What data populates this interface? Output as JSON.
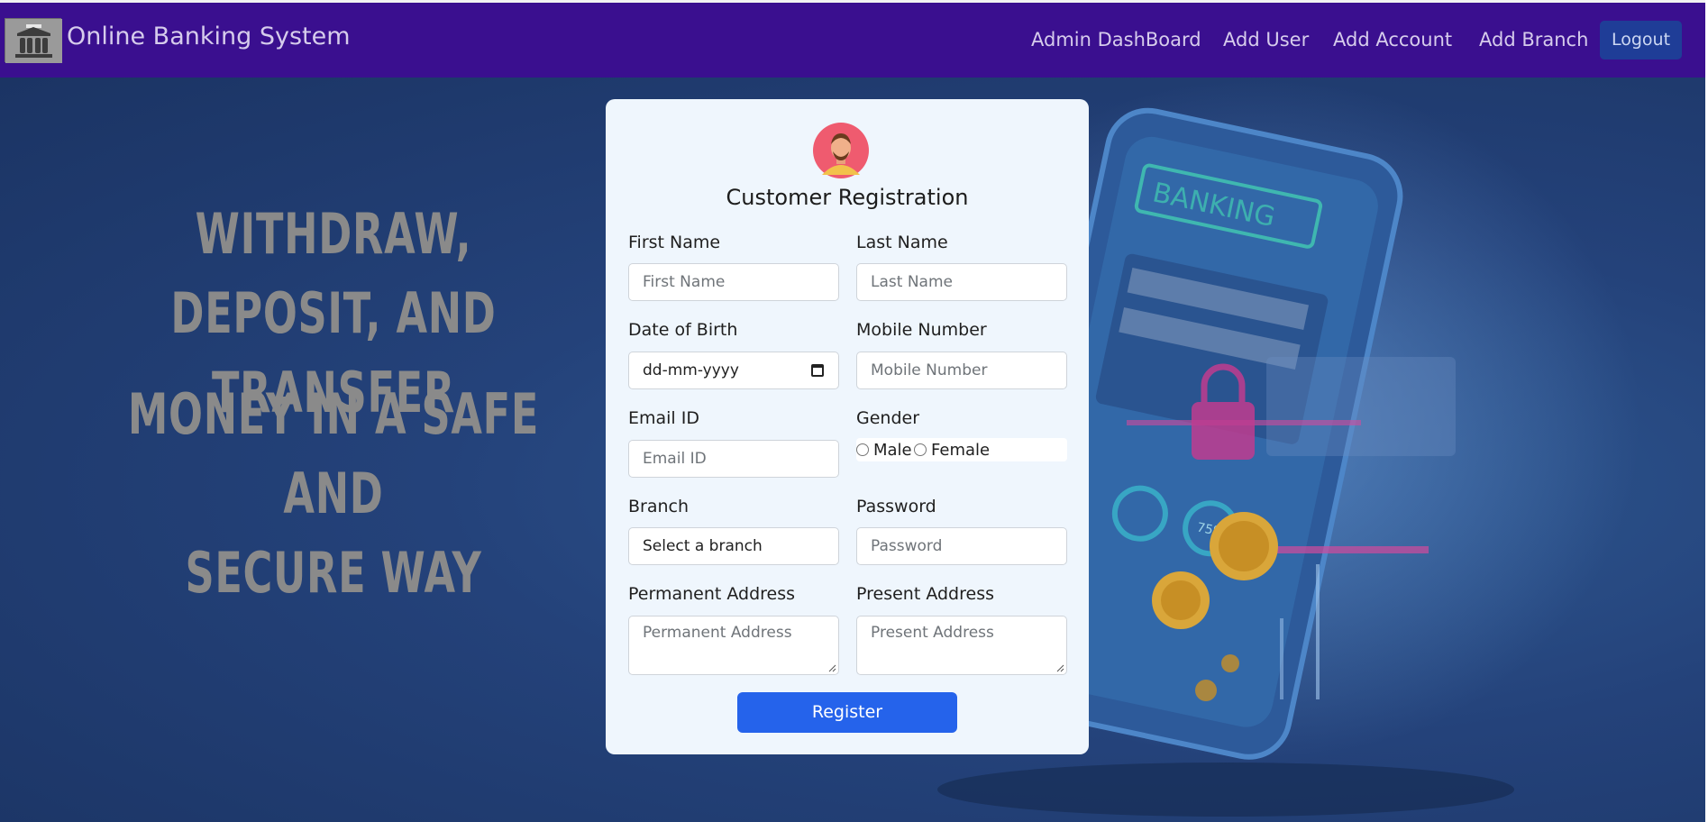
{
  "navbar": {
    "brand_title": "Online Banking System",
    "links": [
      "Admin DashBoard",
      "Add User",
      "Add Account",
      "Add Branch"
    ],
    "logout_label": "Logout"
  },
  "hero": {
    "line1": "WITHDRAW, DEPOSIT, AND",
    "line2": "TRANSFER",
    "line3": "MONEY IN A SAFE AND",
    "line4": "SECURE WAY",
    "art_text": "BANKING",
    "art_percent": "75%"
  },
  "form": {
    "title": "Customer Registration",
    "first_name": {
      "label": "First Name",
      "placeholder": "First Name"
    },
    "last_name": {
      "label": "Last Name",
      "placeholder": "Last Name"
    },
    "dob": {
      "label": "Date of Birth",
      "value": "dd-mm-yyyy"
    },
    "mobile": {
      "label": "Mobile Number",
      "placeholder": "Mobile Number"
    },
    "email": {
      "label": "Email ID",
      "placeholder": "Email ID"
    },
    "gender": {
      "label": "Gender",
      "options": [
        "Male",
        "Female"
      ]
    },
    "branch": {
      "label": "Branch",
      "selected": "Select a branch"
    },
    "password": {
      "label": "Password",
      "placeholder": "Password"
    },
    "permanent_address": {
      "label": "Permanent Address",
      "placeholder": "Permanent Address"
    },
    "present_address": {
      "label": "Present Address",
      "placeholder": "Present Address"
    },
    "register_label": "Register"
  },
  "colors": {
    "navbar": "#3a0f8f",
    "card": "#eff6fd",
    "register_button": "#2563eb",
    "logout_button": "#1f3d97"
  }
}
